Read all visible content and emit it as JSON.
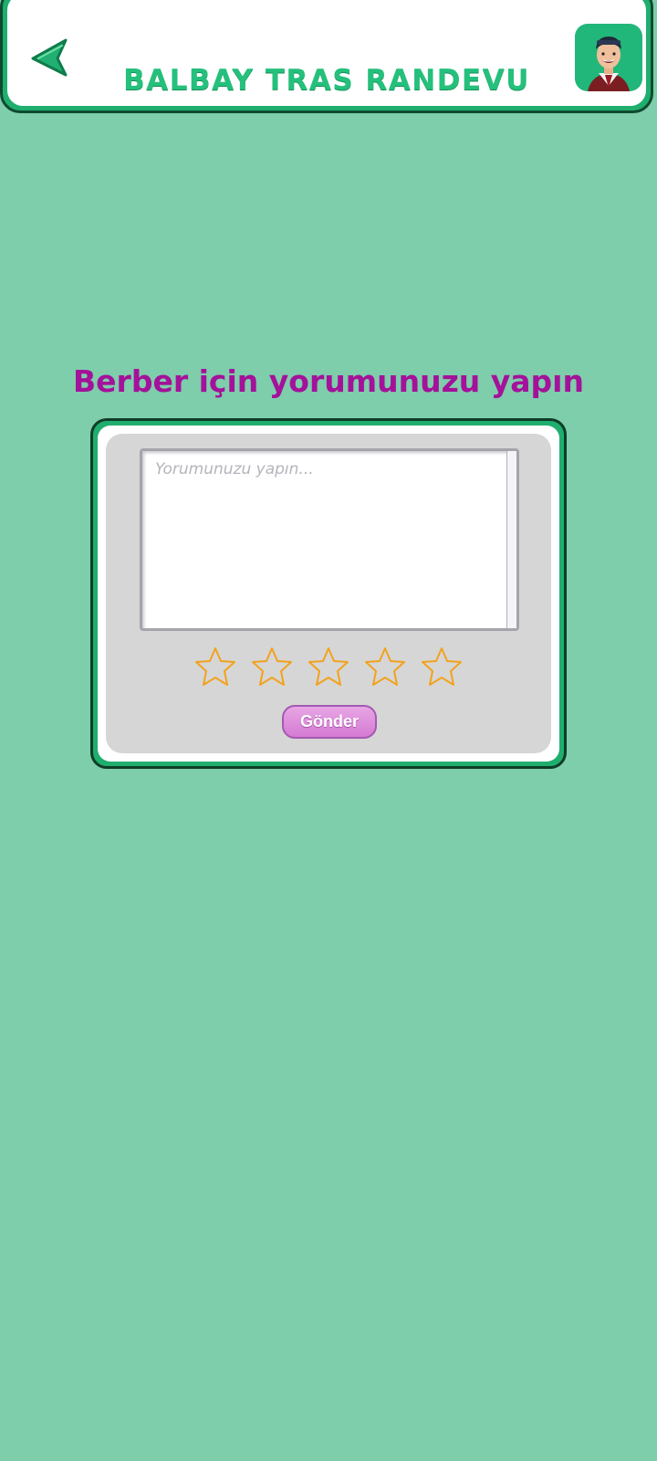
{
  "header": {
    "title": "BALBAY TRAS RANDEVU",
    "back_icon": "back-arrow-icon",
    "avatar_icon": "barber-avatar-icon"
  },
  "main": {
    "title": "Berber için yorumunuzu yapın",
    "comment": {
      "value": "",
      "placeholder": "Yorumunuzu yapın..."
    },
    "rating": {
      "max": 5,
      "value": 0,
      "star_icon": "star-outline-icon"
    },
    "send_label": "Gönder"
  },
  "colors": {
    "background": "#7ecdab",
    "header_title": "#24c07c",
    "card_border": "#1fae6e",
    "section_title": "#a4119a",
    "star_outline": "#f2a21c",
    "send_button": "#d98bd8"
  }
}
